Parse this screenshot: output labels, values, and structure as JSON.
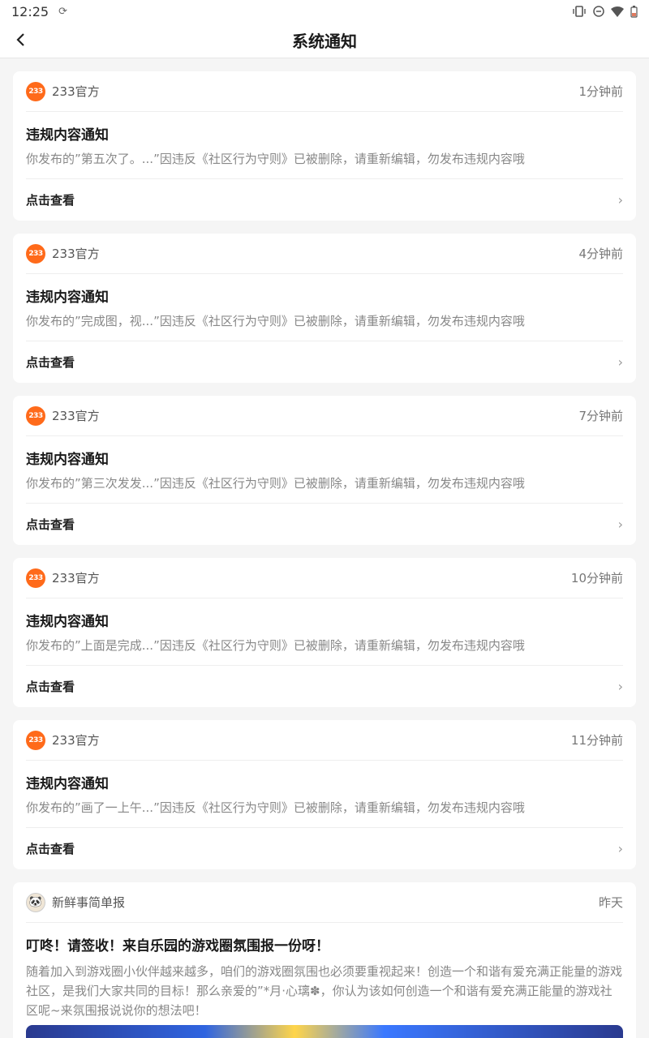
{
  "status_bar": {
    "time": "12:25"
  },
  "header": {
    "title": "系统通知"
  },
  "notifications": [
    {
      "logo": "233",
      "sender": "233官方",
      "time": "1分钟前",
      "title": "违规内容通知",
      "body": "你发布的”第五次了。...”因违反《社区行为守则》已被删除，请重新编辑，勿发布违规内容哦",
      "action": "点击查看"
    },
    {
      "logo": "233",
      "sender": "233官方",
      "time": "4分钟前",
      "title": "违规内容通知",
      "body": "你发布的”完成图，视...”因违反《社区行为守则》已被删除，请重新编辑，勿发布违规内容哦",
      "action": "点击查看"
    },
    {
      "logo": "233",
      "sender": "233官方",
      "time": "7分钟前",
      "title": "违规内容通知",
      "body": "你发布的”第三次发发...”因违反《社区行为守则》已被删除，请重新编辑，勿发布违规内容哦",
      "action": "点击查看"
    },
    {
      "logo": "233",
      "sender": "233官方",
      "time": "10分钟前",
      "title": "违规内容通知",
      "body": "你发布的”上面是完成...”因违反《社区行为守则》已被删除，请重新编辑，勿发布违规内容哦",
      "action": "点击查看"
    },
    {
      "logo": "233",
      "sender": "233官方",
      "time": "11分钟前",
      "title": "违规内容通知",
      "body": "你发布的”画了一上午...”因违反《社区行为守则》已被删除，请重新编辑，勿发布违规内容哦",
      "action": "点击查看"
    }
  ],
  "news": {
    "sender": "新鲜事简单报",
    "time": "昨天",
    "title": "叮咚！请签收！来自乐园的游戏圈氛围报一份呀！",
    "body": "随着加入到游戏圈小伙伴越来越多，咱们的游戏圈氛围也必须要重视起来！创造一个和谐有爱充满正能量的游戏社区，是我们大家共同的目标！那么亲爱的”*月·心璃✽，你认为该如何创造一个和谐有爱充满正能量的游戏社区呢~来氛围报说说你的想法吧！"
  },
  "colors": {
    "brand": "#ff6a1a",
    "background": "#f5f5f5"
  }
}
